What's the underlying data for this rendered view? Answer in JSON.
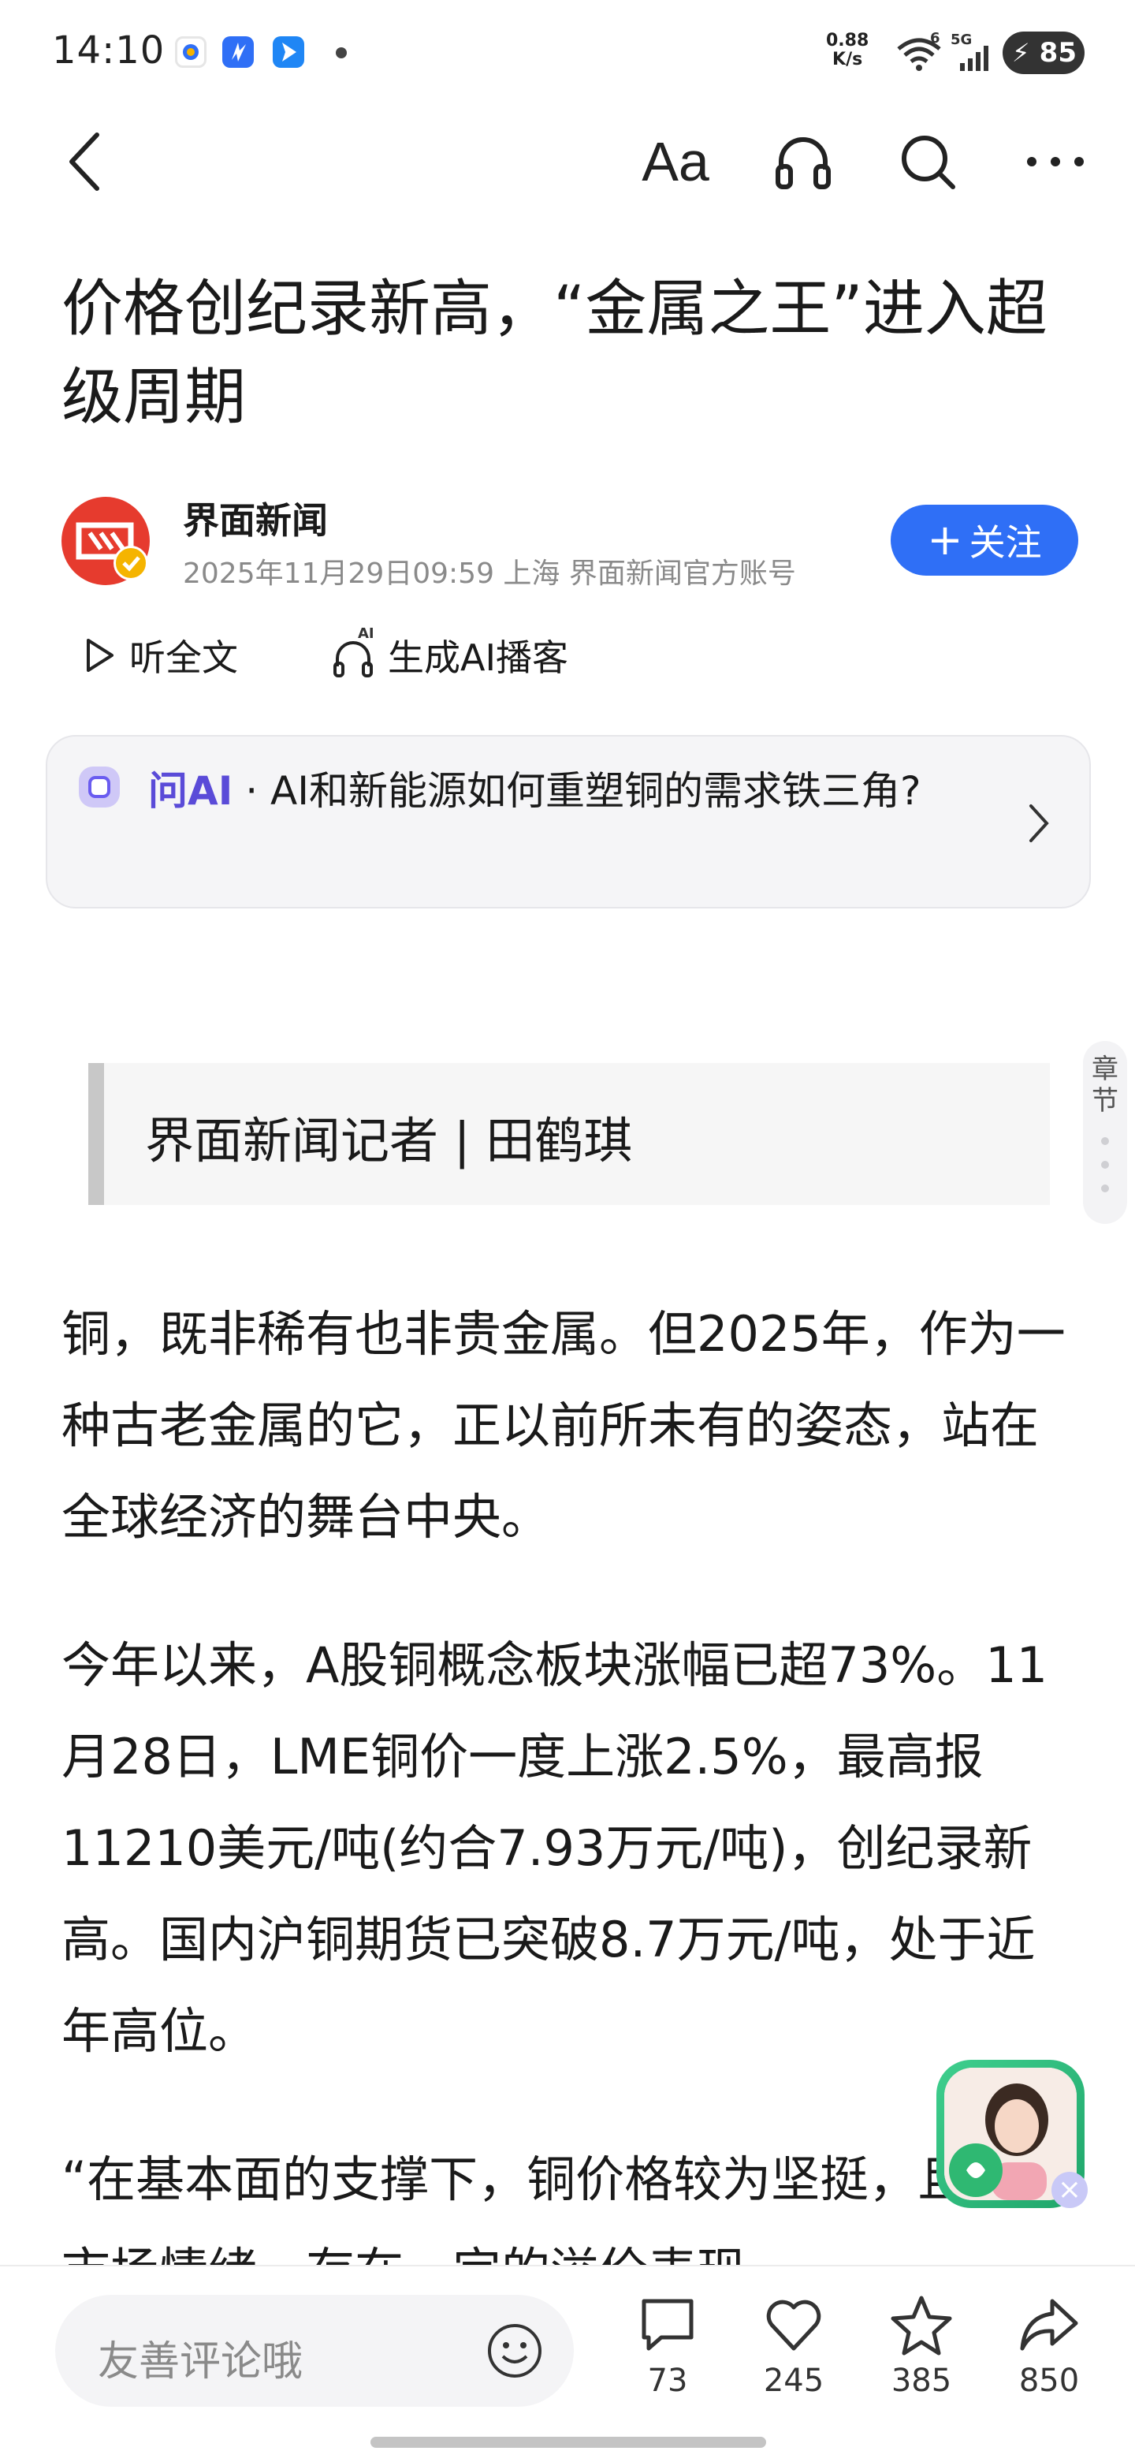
{
  "status_bar": {
    "time": "14:10",
    "net_speed_value": "0.88",
    "net_speed_unit": "K/s",
    "wifi_badge": "6",
    "signal_badge": "5G",
    "battery": "85"
  },
  "nav": {
    "font_size_label": "Aa"
  },
  "article": {
    "title": "价格创纪录新高，“金属之王”进入超级周期",
    "publisher": "界面新闻",
    "meta": "2025年11月29日09:59 上海 界面新闻官方账号",
    "follow_label": "关注",
    "listen_label": "听全文",
    "podcast_label": "生成AI播客",
    "podcast_ai_badge": "AI",
    "byline": "界面新闻记者 | 田鹤琪",
    "paragraphs": [
      "铜，既非稀有也非贵金属。但2025年，作为一种古老金属的它，正以前所未有的姿态，站在全球经济的舞台中央。",
      "今年以来，A股铜概念板块涨幅已超73%。11月28日，LME铜价一度上涨2.5%，最高报11210美元/吨(约合7.93万元/吨)，创纪录新高。国内沪铜期货已突破8.7万元/吨，处于近年高位。",
      "“在基本面的支撑下，铜价格较为坚挺，且叠加市场情绪，存在一定的溢价表现"
    ]
  },
  "ask_ai": {
    "brand": "问AI",
    "question": " · AI和新能源如何重塑铜的需求铁三角?"
  },
  "chapter_tab": {
    "label": "章节"
  },
  "bottom_bar": {
    "comment_placeholder": "友善评论哦",
    "comments": "73",
    "likes": "245",
    "favorites": "385",
    "shares": "850"
  },
  "colors": {
    "accent": "#2f6ff6",
    "ai_purple": "#5a4bd8",
    "brand_red": "#e63b2e"
  }
}
